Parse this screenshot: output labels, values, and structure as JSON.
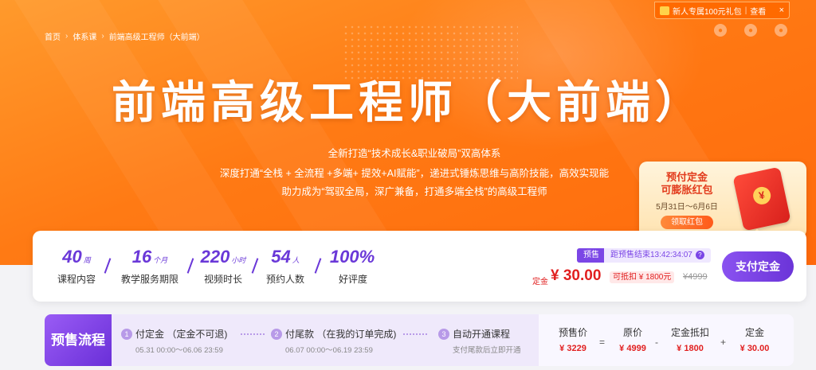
{
  "promo_bar": {
    "text": "新人专属100元礼包",
    "link": "查看",
    "close": "×"
  },
  "breadcrumb": [
    "首页",
    "体系课",
    "前端高级工程师（大前端）"
  ],
  "hero": {
    "title": "前端高级工程师（大前端）",
    "lines": [
      "全新打造“技术成长&职业破局”双高体系",
      "深度打通“全栈 + 全流程 +多端+ 提效+AI赋能”，递进式锤炼思维与高阶技能，高效实现能",
      "助力成为“驾驭全局，深广兼备，打通多端全栈”的高级工程师"
    ]
  },
  "side_promo": {
    "line1": "预付定金",
    "line2": "可膨胀红包",
    "dates": "5月31日～6月6日",
    "button": "领取红包"
  },
  "stats": [
    {
      "num": "40",
      "unit": "周",
      "label": "课程内容"
    },
    {
      "num": "16",
      "unit": "个月",
      "label": "教学服务期限"
    },
    {
      "num": "220",
      "unit": "小时",
      "label": "视频时长"
    },
    {
      "num": "54",
      "unit": "人",
      "label": "预约人数"
    },
    {
      "num": "100%",
      "unit": "",
      "label": "好评度"
    }
  ],
  "presale": {
    "tag": "预售",
    "countdown": "距预售结束13:42:34:07",
    "deposit_label": "定金",
    "deposit_value": "¥ 30.00",
    "offset": "可抵扣 ¥ 1800元",
    "original": "¥4999",
    "pay_button": "支付定金"
  },
  "flow": {
    "title": "预售流程",
    "steps": [
      {
        "n": "1",
        "title": "付定金 （定金不可退)",
        "sub": "05.31 00:00～06.06 23:59"
      },
      {
        "n": "2",
        "title": "付尾款 （在我的订单完成)",
        "sub": "06.07 00:00～06.19 23:59"
      },
      {
        "n": "3",
        "title": "自动开通课程",
        "sub": "支付尾款后立即开通"
      }
    ],
    "prices": [
      {
        "k": "预售价",
        "v": "¥ 3229"
      },
      {
        "k": "原价",
        "v": "¥ 4999"
      },
      {
        "k": "定金抵扣",
        "v": "¥ 1800"
      },
      {
        "k": "定金",
        "v": "¥ 30.00"
      }
    ],
    "ops": [
      "=",
      "-",
      "+"
    ]
  }
}
